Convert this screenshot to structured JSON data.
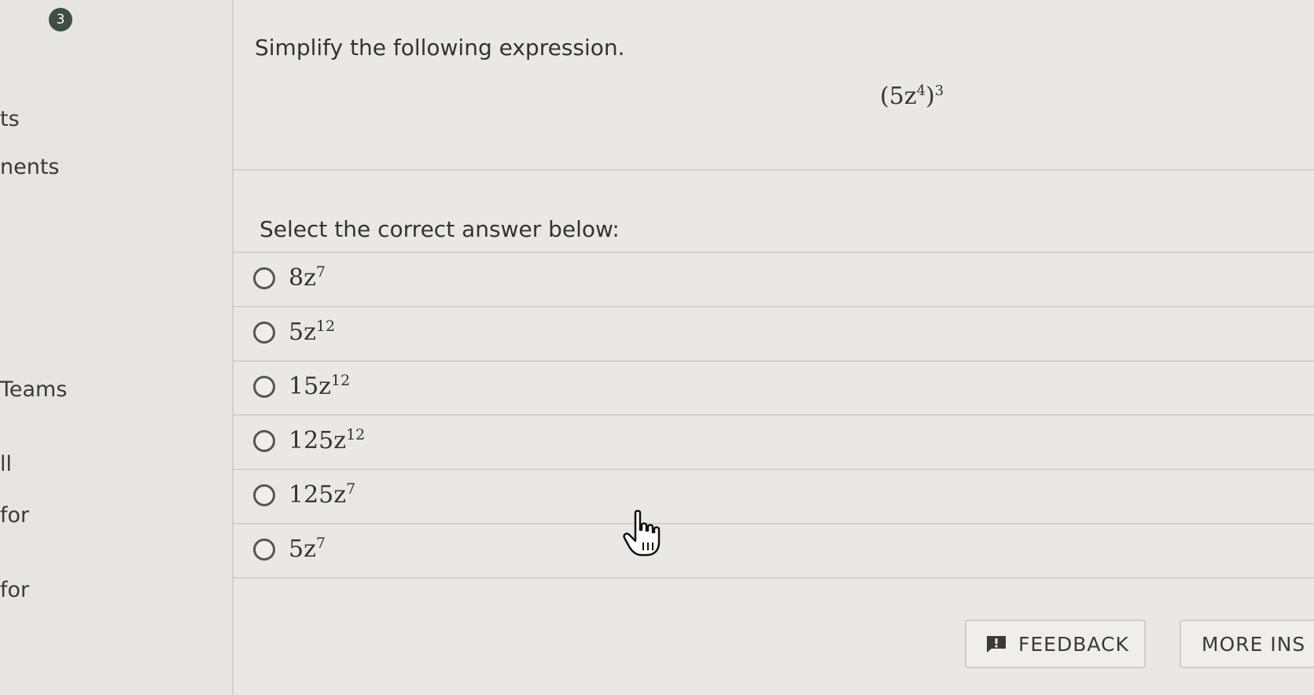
{
  "sidebar": {
    "question_number": "3",
    "items": [
      {
        "label": "ts"
      },
      {
        "label": "nents"
      },
      {
        "label": "Teams"
      },
      {
        "label": "ll"
      },
      {
        "label": "for"
      },
      {
        "label": "for"
      }
    ]
  },
  "question": {
    "prompt": "Simplify the following expression.",
    "expression": {
      "base": "(5z",
      "inner_exp": "4",
      "close": ")",
      "outer_exp": "3"
    },
    "select_label": "Select the correct answer below:"
  },
  "options": [
    {
      "coef": "8z",
      "exp": "7"
    },
    {
      "coef": "5z",
      "exp": "12"
    },
    {
      "coef": "15z",
      "exp": "12"
    },
    {
      "coef": "125z",
      "exp": "12"
    },
    {
      "coef": "125z",
      "exp": "7"
    },
    {
      "coef": "5z",
      "exp": "7"
    }
  ],
  "footer": {
    "feedback_label": "FEEDBACK",
    "more_label": "MORE INS"
  },
  "icons": {
    "question_badge": "numbered-circle-icon",
    "feedback": "feedback-icon",
    "cursor": "hand-pointer-icon"
  },
  "colors": {
    "badge": "#3f4d47",
    "background": "#e9e8e5"
  }
}
